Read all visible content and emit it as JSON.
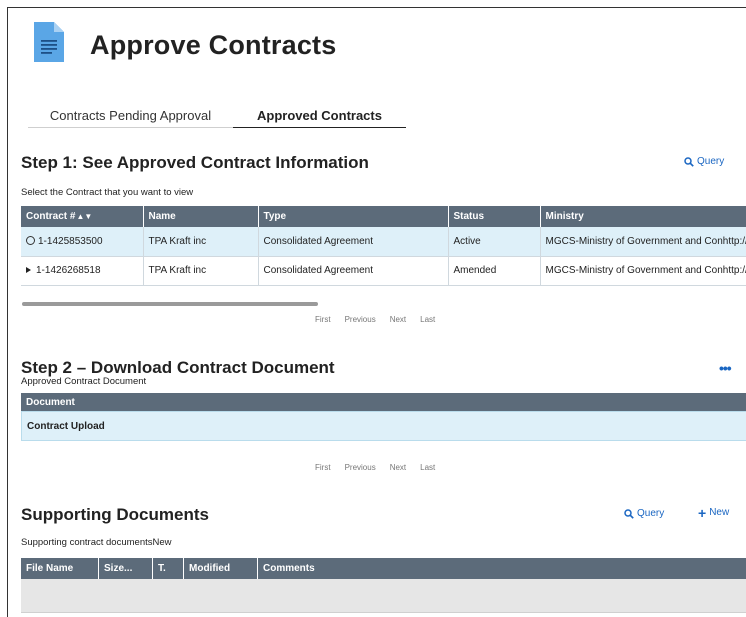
{
  "page": {
    "title": "Approve Contracts",
    "icon": "document-icon"
  },
  "tabs": [
    {
      "label": "Contracts Pending Approval",
      "active": false
    },
    {
      "label": "Approved Contracts",
      "active": true
    }
  ],
  "step1": {
    "title": "Step 1: See Approved Contract Information",
    "query_label": "Query",
    "instruction": "Select the Contract that you want to view",
    "columns": [
      "Contract #",
      "Name",
      "Type",
      "Status",
      "Ministry"
    ],
    "rows": [
      {
        "contract": "1-1425853500",
        "name": "TPA Kraft inc",
        "type": "Consolidated Agreement",
        "status": "Active",
        "ministry": "MGCS-Ministry of Government and Conhttp://",
        "selected": true
      },
      {
        "contract": "1-1426268518",
        "name": "TPA Kraft inc",
        "type": "Consolidated Agreement",
        "status": "Amended",
        "ministry": "MGCS-Ministry of Government and Conhttp://",
        "selected": false
      }
    ],
    "pager": {
      "first": "First",
      "previous": "Previous",
      "next": "Next",
      "last": "Last"
    }
  },
  "step2": {
    "title": "Step 2 – Download Contract Document",
    "subtitle": "Approved Contract Document",
    "more_label": "•••",
    "column": "Document",
    "row": "Contract Upload",
    "pager": {
      "first": "First",
      "previous": "Previous",
      "next": "Next",
      "last": "Last"
    }
  },
  "supporting": {
    "title": "Supporting Documents",
    "query_label": "Query",
    "new_label": "New",
    "subtitle": "Supporting contract documentsNew",
    "columns": [
      "File Name",
      "Size...",
      "T.",
      "Modified",
      "Comments"
    ]
  },
  "colors": {
    "header_bg": "#5c6b7a",
    "selected_row": "#def0f9",
    "link": "#1a66c2",
    "icon": "#5aa6e6"
  }
}
